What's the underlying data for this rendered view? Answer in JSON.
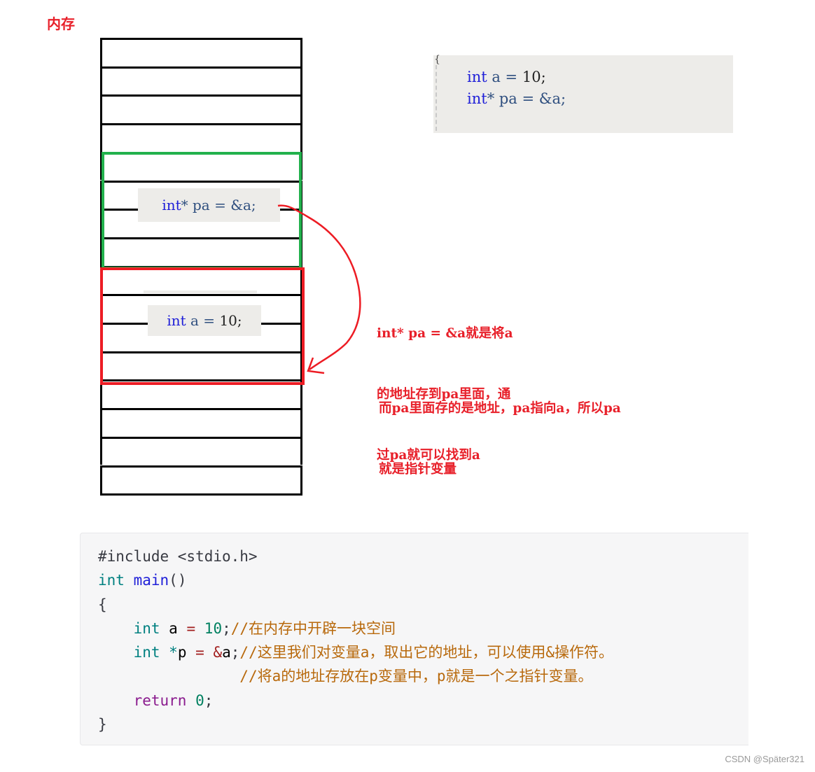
{
  "title": "内存",
  "memory": {
    "cell_count": 16,
    "pointer_cell_label": "int* pa = &a;",
    "pointer_cell_parts": [
      "int",
      "* pa = &a;"
    ],
    "value_cell_label": "int a = 10;",
    "value_cell_parts": [
      "int",
      " a = ",
      "10",
      ";"
    ],
    "pointer_box_color": "#22b14c",
    "value_box_color": "#ed1c24"
  },
  "snippet": {
    "brace": "{",
    "lines": [
      {
        "kw": "int",
        "rest": " a = ",
        "num": "10",
        "end": ";"
      },
      {
        "kw": "int",
        "rest": "* pa = &a;",
        "num": "",
        "end": ""
      }
    ]
  },
  "notes": {
    "note1_lines": [
      "int* pa = &a就是将a",
      "的地址存到pa里面，通",
      "过pa就可以找到a"
    ],
    "note2_lines": [
      "而pa里面存的是地址，pa指向a，所以pa",
      "就是指针变量"
    ],
    "color": "#e8202a"
  },
  "code": {
    "line1": "#include <stdio.h>",
    "line2_kw": "int",
    "line2_fn": "main",
    "line2_rest": "()",
    "line3": "{",
    "line4_kw": "int",
    "line4_var": "a",
    "line4_op": "=",
    "line4_num": "10",
    "line4_semi": ";",
    "line4_comment": "//在内存中开辟一块空间",
    "line5_kw": "int",
    "line5_ptr": "*",
    "line5_var": "p",
    "line5_op": "=",
    "line5_amp": "&",
    "line5_var2": "a",
    "line5_semi": ";",
    "line5_comment": "//这里我们对变量a，取出它的地址，可以使用&操作符。",
    "line6_comment": "//将a的地址存放在p变量中，p就是一个之指针变量。",
    "line7_kw": "return",
    "line7_num": "0",
    "line7_semi": ";",
    "line8": "}"
  },
  "watermark": "CSDN @Später321"
}
